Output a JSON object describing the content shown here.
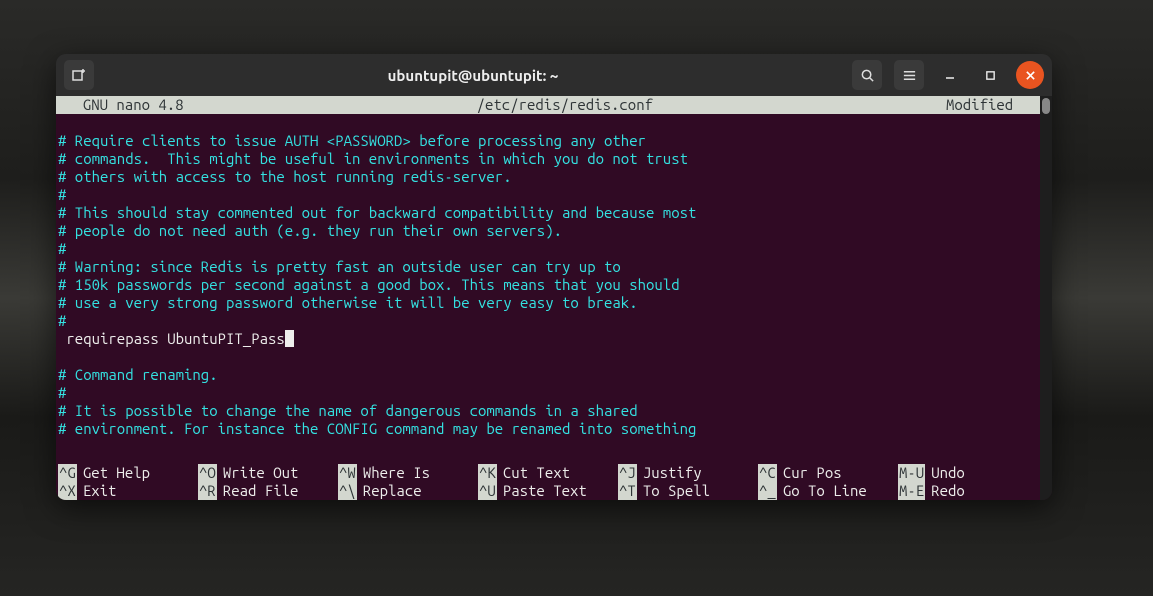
{
  "window": {
    "title": "ubuntupit@ubuntupit: ~"
  },
  "nano": {
    "header_left": "  GNU nano 4.8",
    "header_center": "/etc/redis/redis.conf",
    "header_right": "Modified  ",
    "lines": [
      {
        "text": "# Require clients to issue AUTH <PASSWORD> before processing any other",
        "comment": true
      },
      {
        "text": "# commands.  This might be useful in environments in which you do not trust",
        "comment": true
      },
      {
        "text": "# others with access to the host running redis-server.",
        "comment": true
      },
      {
        "text": "#",
        "comment": true
      },
      {
        "text": "# This should stay commented out for backward compatibility and because most",
        "comment": true
      },
      {
        "text": "# people do not need auth (e.g. they run their own servers).",
        "comment": true
      },
      {
        "text": "#",
        "comment": true
      },
      {
        "text": "# Warning: since Redis is pretty fast an outside user can try up to",
        "comment": true
      },
      {
        "text": "# 150k passwords per second against a good box. This means that you should",
        "comment": true
      },
      {
        "text": "# use a very strong password otherwise it will be very easy to break.",
        "comment": true
      },
      {
        "text": "#",
        "comment": true
      },
      {
        "text": " requirepass UbuntuPIT_Pass",
        "comment": false,
        "cursor": true
      },
      {
        "text": "",
        "comment": false
      },
      {
        "text": "# Command renaming.",
        "comment": true
      },
      {
        "text": "#",
        "comment": true
      },
      {
        "text": "# It is possible to change the name of dangerous commands in a shared",
        "comment": true
      },
      {
        "text": "# environment. For instance the CONFIG command may be renamed into something",
        "comment": true
      }
    ],
    "shortcuts_row1": [
      {
        "key": "^G",
        "action": "Get Help"
      },
      {
        "key": "^O",
        "action": "Write Out"
      },
      {
        "key": "^W",
        "action": "Where Is"
      },
      {
        "key": "^K",
        "action": "Cut Text"
      },
      {
        "key": "^J",
        "action": "Justify"
      },
      {
        "key": "^C",
        "action": "Cur Pos"
      },
      {
        "key": "M-U",
        "action": "Undo"
      }
    ],
    "shortcuts_row2": [
      {
        "key": "^X",
        "action": "Exit"
      },
      {
        "key": "^R",
        "action": "Read File"
      },
      {
        "key": "^\\",
        "action": "Replace"
      },
      {
        "key": "^U",
        "action": "Paste Text"
      },
      {
        "key": "^T",
        "action": "To Spell"
      },
      {
        "key": "^_",
        "action": "Go To Line"
      },
      {
        "key": "M-E",
        "action": "Redo"
      }
    ]
  }
}
